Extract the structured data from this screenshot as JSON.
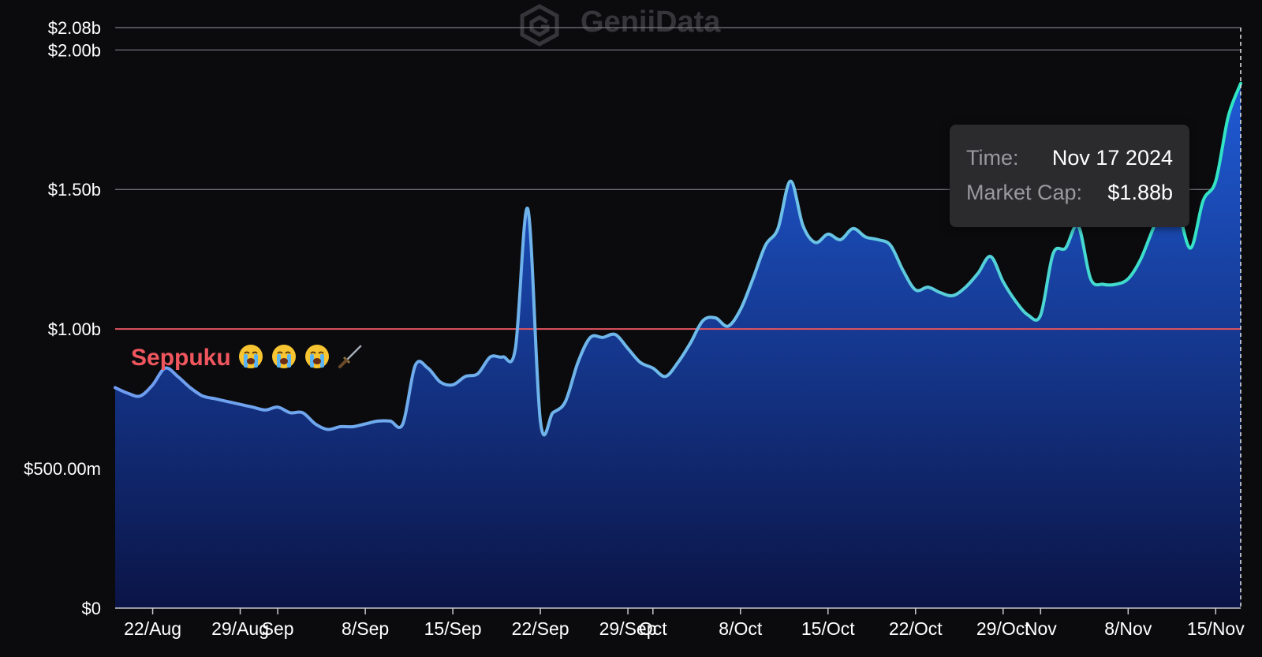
{
  "watermark": "GeniiData",
  "tooltip": {
    "time_label": "Time:",
    "time_value": "Nov 17 2024",
    "cap_label": "Market Cap:",
    "cap_value": "$1.88b"
  },
  "annotation": {
    "text": "Seppuku",
    "emoji_icons": [
      "loudly-crying-face-icon",
      "loudly-crying-face-icon",
      "loudly-crying-face-icon",
      "dagger-icon"
    ]
  },
  "colors": {
    "background": "#0b0b0e",
    "line_start": "#6f9cf0",
    "line_end": "#2fe6c2",
    "area_top": "#1f5bd6",
    "area_bottom": "#0b1446",
    "threshold": "#e25560",
    "grid": "#7a7a82",
    "annotation": "#f0565e"
  },
  "chart_data": {
    "type": "area",
    "x_axis": {
      "type": "date",
      "range": [
        "2024-08-19",
        "2024-11-17"
      ],
      "tick_labels": [
        {
          "date": "2024-08-22",
          "label": "22/Aug"
        },
        {
          "date": "2024-08-29",
          "label": "29/Aug"
        },
        {
          "date": "2024-09-01",
          "label": "Sep"
        },
        {
          "date": "2024-09-08",
          "label": "8/Sep"
        },
        {
          "date": "2024-09-15",
          "label": "15/Sep"
        },
        {
          "date": "2024-09-22",
          "label": "22/Sep"
        },
        {
          "date": "2024-09-29",
          "label": "29/Sep"
        },
        {
          "date": "2024-10-01",
          "label": "Oct"
        },
        {
          "date": "2024-10-08",
          "label": "8/Oct"
        },
        {
          "date": "2024-10-15",
          "label": "15/Oct"
        },
        {
          "date": "2024-10-22",
          "label": "22/Oct"
        },
        {
          "date": "2024-10-29",
          "label": "29/Oct"
        },
        {
          "date": "2024-11-01",
          "label": "Nov"
        },
        {
          "date": "2024-11-08",
          "label": "8/Nov"
        },
        {
          "date": "2024-11-15",
          "label": "15/Nov"
        }
      ]
    },
    "y_axis": {
      "range": [
        0,
        2.08
      ],
      "unit": "billion USD",
      "ticks": [
        {
          "value": 0,
          "label": "$0"
        },
        {
          "value": 0.5,
          "label": "$500.00m"
        },
        {
          "value": 1.0,
          "label": "$1.00b"
        },
        {
          "value": 1.5,
          "label": "$1.50b"
        },
        {
          "value": 2.0,
          "label": "$2.00b"
        },
        {
          "value": 2.08,
          "label": "$2.08b"
        }
      ]
    },
    "threshold_line": 1.0,
    "series": [
      {
        "x": [
          "2024-08-19",
          "2024-08-20",
          "2024-08-21",
          "2024-08-22",
          "2024-08-23",
          "2024-08-24",
          "2024-08-25",
          "2024-08-26",
          "2024-08-27",
          "2024-08-28",
          "2024-08-29",
          "2024-08-30",
          "2024-08-31",
          "2024-09-01",
          "2024-09-02",
          "2024-09-03",
          "2024-09-04",
          "2024-09-05",
          "2024-09-06",
          "2024-09-07",
          "2024-09-08",
          "2024-09-09",
          "2024-09-10",
          "2024-09-11",
          "2024-09-12",
          "2024-09-13",
          "2024-09-14",
          "2024-09-15",
          "2024-09-16",
          "2024-09-17",
          "2024-09-18",
          "2024-09-19",
          "2024-09-20",
          "2024-09-21",
          "2024-09-22",
          "2024-09-23",
          "2024-09-24",
          "2024-09-25",
          "2024-09-26",
          "2024-09-27",
          "2024-09-28",
          "2024-09-29",
          "2024-09-30",
          "2024-10-01",
          "2024-10-02",
          "2024-10-03",
          "2024-10-04",
          "2024-10-05",
          "2024-10-06",
          "2024-10-07",
          "2024-10-08",
          "2024-10-09",
          "2024-10-10",
          "2024-10-11",
          "2024-10-12",
          "2024-10-13",
          "2024-10-14",
          "2024-10-15",
          "2024-10-16",
          "2024-10-17",
          "2024-10-18",
          "2024-10-19",
          "2024-10-20",
          "2024-10-21",
          "2024-10-22",
          "2024-10-23",
          "2024-10-24",
          "2024-10-25",
          "2024-10-26",
          "2024-10-27",
          "2024-10-28",
          "2024-10-29",
          "2024-10-30",
          "2024-10-31",
          "2024-11-01",
          "2024-11-02",
          "2024-11-03",
          "2024-11-04",
          "2024-11-05",
          "2024-11-06",
          "2024-11-07",
          "2024-11-08",
          "2024-11-09",
          "2024-11-10",
          "2024-11-11",
          "2024-11-12",
          "2024-11-13",
          "2024-11-14",
          "2024-11-15",
          "2024-11-16",
          "2024-11-17"
        ],
        "values": [
          0.79,
          0.77,
          0.76,
          0.8,
          0.86,
          0.83,
          0.79,
          0.76,
          0.75,
          0.74,
          0.73,
          0.72,
          0.71,
          0.72,
          0.7,
          0.7,
          0.66,
          0.64,
          0.65,
          0.65,
          0.66,
          0.67,
          0.67,
          0.66,
          0.87,
          0.86,
          0.81,
          0.8,
          0.83,
          0.84,
          0.9,
          0.9,
          0.93,
          1.43,
          0.67,
          0.7,
          0.74,
          0.88,
          0.97,
          0.97,
          0.98,
          0.93,
          0.88,
          0.86,
          0.83,
          0.88,
          0.95,
          1.03,
          1.04,
          1.01,
          1.07,
          1.18,
          1.3,
          1.36,
          1.53,
          1.37,
          1.31,
          1.34,
          1.32,
          1.36,
          1.33,
          1.32,
          1.3,
          1.21,
          1.14,
          1.15,
          1.13,
          1.12,
          1.15,
          1.2,
          1.26,
          1.17,
          1.1,
          1.05,
          1.05,
          1.27,
          1.29,
          1.37,
          1.18,
          1.16,
          1.16,
          1.18,
          1.25,
          1.36,
          1.46,
          1.42,
          1.29,
          1.46,
          1.53,
          1.76,
          1.88
        ]
      }
    ]
  }
}
